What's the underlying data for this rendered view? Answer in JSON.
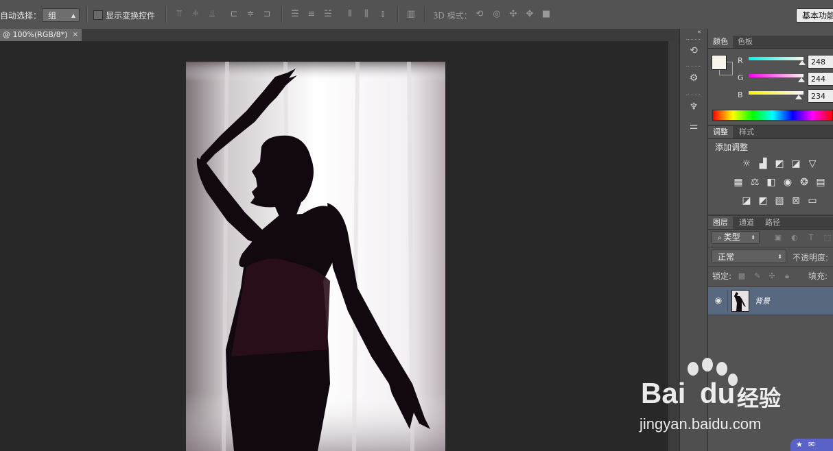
{
  "options_bar": {
    "auto_select_label": "自动选择：",
    "auto_select_value": "组",
    "show_transform_label": "显示变换控件",
    "mode_3d_label": "3D 模式：",
    "workspace_label": "基本功能"
  },
  "document": {
    "tab_label": "@ 100%(RGB/8*)",
    "close_glyph": "×"
  },
  "color_panel": {
    "tabs": [
      "颜色",
      "色板"
    ],
    "channels": [
      {
        "name": "R",
        "value": "248"
      },
      {
        "name": "G",
        "value": "244"
      },
      {
        "name": "B",
        "value": "234"
      }
    ],
    "foreground_color": "#f8f4ea",
    "background_color": "#535353"
  },
  "adjustments_panel": {
    "tabs": [
      "调整",
      "样式"
    ],
    "title": "添加调整",
    "icons_row1": [
      "brightness-contrast-icon",
      "levels-icon",
      "curves-icon",
      "exposure-icon",
      "vibrance-icon"
    ],
    "icons_row2": [
      "hue-saturation-icon",
      "color-balance-icon",
      "black-white-icon",
      "photo-filter-icon",
      "channel-mixer-icon",
      "color-lookup-icon"
    ],
    "icons_row3": [
      "invert-icon",
      "posterize-icon",
      "threshold-icon",
      "selective-color-icon",
      "gradient-map-icon"
    ]
  },
  "layers_panel": {
    "tabs": [
      "图层",
      "通道",
      "路径"
    ],
    "filter_label": "类型",
    "blend_mode": "正常",
    "opacity_label": "不透明度:",
    "lock_label": "锁定:",
    "fill_label": "填充:",
    "layers": [
      {
        "name": "背景",
        "visible": true,
        "selected": true
      }
    ]
  },
  "watermark": {
    "logo_text": "Bai",
    "logo_text2": "du",
    "cn_text": "经验",
    "url": "jingyan.baidu.com"
  }
}
